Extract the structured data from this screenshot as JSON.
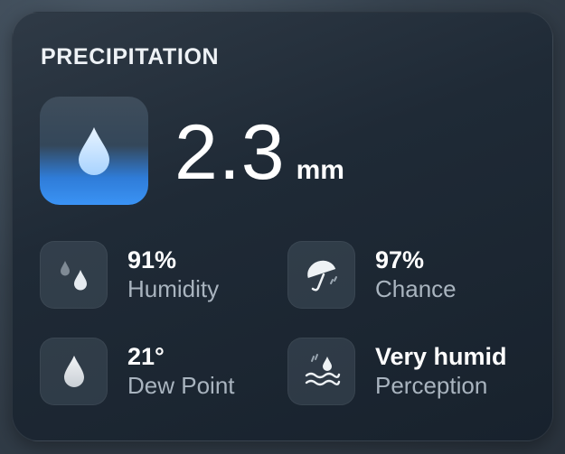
{
  "card": {
    "title": "PRECIPITATION",
    "hero": {
      "value": "2.3",
      "unit": "mm",
      "icon": "raindrop-icon"
    },
    "stats": [
      {
        "value": "91%",
        "label": "Humidity",
        "icon": "humidity-drops-icon"
      },
      {
        "value": "97%",
        "label": "Chance",
        "icon": "umbrella-rain-icon"
      },
      {
        "value": "21°",
        "label": "Dew Point",
        "icon": "dew-drop-icon"
      },
      {
        "value": "Very humid",
        "label": "Perception",
        "icon": "humid-waves-icon"
      }
    ]
  },
  "colors": {
    "accent_blue": "#3a93f5",
    "label_gray": "#a9b4bf",
    "text_white": "#ffffff"
  }
}
